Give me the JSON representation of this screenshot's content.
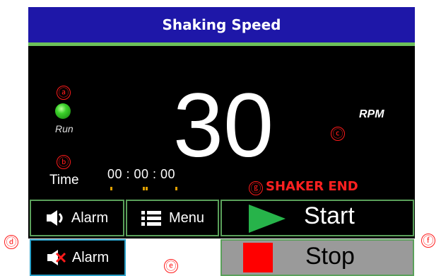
{
  "header": {
    "title": "Shaking Speed"
  },
  "markers": {
    "a": "ⓐ",
    "b": "ⓑ",
    "c": "ⓒ",
    "d": "ⓓ",
    "e": "ⓔ",
    "f": "ⓕ",
    "g": "ⓖ"
  },
  "status_indicator": {
    "label": "Run",
    "color": "#3bd12a"
  },
  "speed": {
    "value": "30",
    "unit": "RPM"
  },
  "timer": {
    "label": "Time",
    "value": "00 : 00 : 00"
  },
  "status_message": "SHAKER END",
  "buttons": {
    "alarm": {
      "label": "Alarm",
      "icon": "speaker-on-icon"
    },
    "menu": {
      "label": "Menu",
      "icon": "list-icon"
    },
    "start": {
      "label": "Start",
      "icon": "play-icon"
    },
    "alarm_off": {
      "label": "Alarm",
      "icon": "speaker-muted-icon"
    },
    "stop": {
      "label": "Stop",
      "icon": "stop-icon"
    }
  },
  "colors": {
    "title_bar": "#1e17a8",
    "accent_line": "#6cc05a",
    "status_red": "#ff2020",
    "start_green": "#27b34a",
    "stop_red": "#ff0000"
  }
}
